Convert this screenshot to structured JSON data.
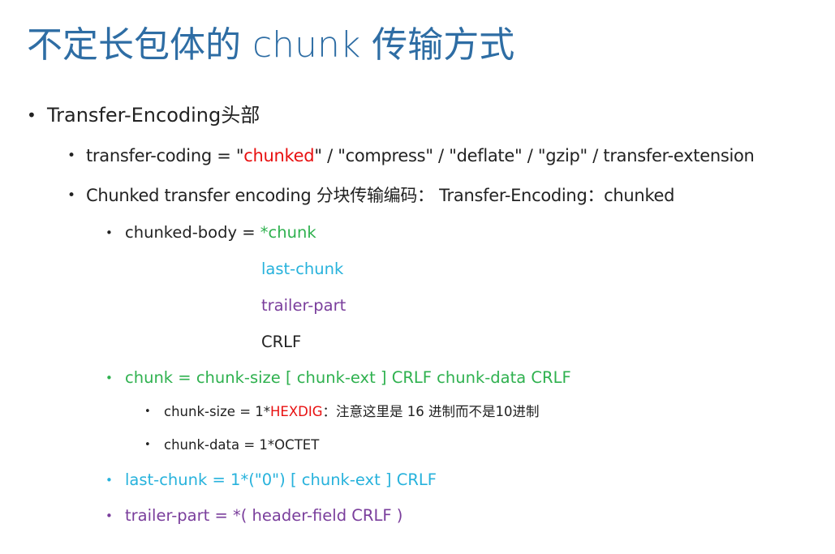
{
  "colors": {
    "title": "#2e6da4",
    "text": "#222222",
    "red": "#e81010",
    "green": "#2fb14f",
    "blue": "#27b2dc",
    "purple": "#7a3e9c"
  },
  "slide": {
    "title": "不定长包体的 chunk 传输方式",
    "bullet_char": "•",
    "items": {
      "header": "Transfer-Encoding头部",
      "coding_prefix": "transfer-coding = \"",
      "coding_chunked": "chunked",
      "coding_suffix": "\" / \"compress\" / \"deflate\" / \"gzip\" / transfer-extension",
      "chunked_te": "Chunked transfer encoding 分块传输编码： Transfer-Encoding：chunked",
      "body_prefix": "chunked-body = ",
      "body_chunk": "*chunk",
      "body_last_chunk": "last-chunk",
      "body_trailer_part": "trailer-part",
      "body_crlf": "CRLF",
      "chunk_def": "chunk = chunk-size [ chunk-ext ] CRLF chunk-data CRLF",
      "size_prefix": "chunk-size = 1*",
      "size_hexdig": "HEXDIG",
      "size_suffix": "：注意这里是 16 进制而不是10进制",
      "data_def": "chunk-data = 1*OCTET",
      "last_chunk_def": "last-chunk = 1*(\"0\") [ chunk-ext ] CRLF",
      "trailer_def": "trailer-part = *( header-field CRLF )"
    }
  }
}
